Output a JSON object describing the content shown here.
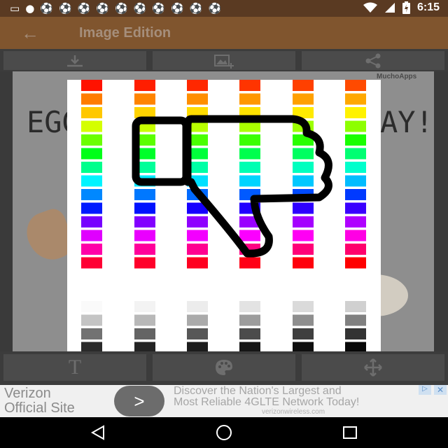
{
  "status": {
    "time": "6:15",
    "notification_icons": [
      "message-icon",
      "community-icon",
      "soccer-ball-icon",
      "soccer-ball-icon",
      "soccer-ball-icon",
      "soccer-ball-icon",
      "soccer-ball-icon",
      "soccer-ball-icon",
      "soccer-ball-icon",
      "soccer-ball-icon",
      "soccer-ball-icon",
      "soccer-ball-icon"
    ],
    "system_icons": [
      "wifi-icon",
      "cell-signal-icon",
      "battery-charging-icon"
    ]
  },
  "appbar": {
    "title": "Image Edition",
    "back_icon": "arrow-back-icon"
  },
  "toolbar": {
    "buttons": [
      "download-icon",
      "add-photo-icon",
      "share-icon"
    ]
  },
  "poster": {
    "text_left": "EGG",
    "text_right": "AY!",
    "watermark": "MuchoApps"
  },
  "palette": {
    "column_colors": [
      [
        "#ff1200",
        "#ff7c00",
        "#ffc800",
        "#d4ff00",
        "#6bff00",
        "#00ff18",
        "#00ff8c",
        "#00f4ff",
        "#0088ff",
        "#001bff",
        "#7700ff",
        "#e000ff",
        "#ff00a8",
        "#ff0034"
      ],
      [
        "#ff1e00",
        "#ff8400",
        "#ffd200",
        "#c7ff00",
        "#5bff00",
        "#00ff2a",
        "#00ff99",
        "#00eaff",
        "#0078ff",
        "#0012ff",
        "#8200ff",
        "#ea00ff",
        "#ff009a",
        "#ff002a"
      ],
      [
        "#ff2800",
        "#ff8e00",
        "#ffdb00",
        "#b8ff00",
        "#4aff00",
        "#00ff3a",
        "#00ffa6",
        "#00e0ff",
        "#006aff",
        "#1600ff",
        "#8f00ff",
        "#f300ff",
        "#ff0090",
        "#ff0020"
      ],
      [
        "#ff3400",
        "#ff9700",
        "#ffe200",
        "#aaff00",
        "#3aff00",
        "#00ff4d",
        "#00ffb2",
        "#00d4ff",
        "#005aff",
        "#2200ff",
        "#9a00ff",
        "#fb00ff",
        "#ff0084",
        "#ff0016"
      ],
      [
        "#ff4000",
        "#ffa000",
        "#ffea00",
        "#9cff00",
        "#29ff00",
        "#00ff60",
        "#00ffbf",
        "#00c8ff",
        "#004aff",
        "#2e00ff",
        "#a500ff",
        "#ff00f4",
        "#ff0078",
        "#ff000c"
      ],
      [
        "#ff4a00",
        "#ffa800",
        "#fff200",
        "#8dff00",
        "#18ff00",
        "#00ff72",
        "#00ffcc",
        "#00bcff",
        "#003aff",
        "#3a00ff",
        "#b000ff",
        "#ff00e4",
        "#ff006c",
        "#ff0000"
      ]
    ],
    "gray_rows": [
      [
        "#fafafa",
        "#f3f3f3",
        "#ececec",
        "#e3e3e3",
        "#dadada",
        "#d0d0d0"
      ],
      [
        "#c4c4c4",
        "#b8b8b8",
        "#aaaaaa",
        "#9c9c9c",
        "#8e8e8e",
        "#808080"
      ],
      [
        "#727272",
        "#646464",
        "#575757",
        "#4b4b4b",
        "#3f3f3f",
        "#333333"
      ],
      [
        "#2a2a2a",
        "#232323",
        "#1c1c1c",
        "#151515",
        "#0e0e0e",
        "#070707"
      ]
    ],
    "overlay_icon": "thumbs-down-icon"
  },
  "bottombar": {
    "buttons": [
      "text-icon",
      "palette-icon",
      "move-icon"
    ],
    "text_glyph": "T"
  },
  "ad": {
    "brand_line1": "Verizon",
    "brand_line2": "Official Site",
    "go_label": ">",
    "line1": "Discover the Nation's Largest and",
    "line2": "Most Reliable 4GLTE Network Today!",
    "url": "verizonwireless.com",
    "badge": "▷",
    "close": "✕"
  },
  "navbar": {
    "buttons": [
      "back-nav-icon",
      "home-nav-icon",
      "recents-nav-icon"
    ]
  }
}
